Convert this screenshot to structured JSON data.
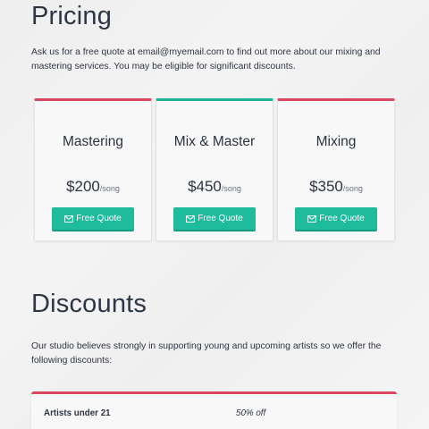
{
  "pricing": {
    "title": "Pricing",
    "intro": "Ask us for a free quote at email@myemail.com to find out more about our mixing and mastering services. You may be eligible for significant discounts.",
    "cards": [
      {
        "name": "Mastering",
        "price": "$200",
        "unit": "/song",
        "button_label": "Free Quote",
        "accent": "#d9485f"
      },
      {
        "name": "Mix & Master",
        "price": "$450",
        "unit": "/song",
        "button_label": "Free Quote",
        "accent": "#1fb394"
      },
      {
        "name": "Mixing",
        "price": "$350",
        "unit": "/song",
        "button_label": "Free Quote",
        "accent": "#d9485f"
      }
    ]
  },
  "discounts": {
    "title": "Discounts",
    "intro": "Our studio believes strongly in supporting young and upcoming artists so we offer the following discounts:",
    "rows": [
      {
        "label": "Artists under 21",
        "value": "50% off"
      }
    ]
  },
  "colors": {
    "button": "#1ebc9c",
    "accent_red": "#d9485f",
    "accent_teal": "#1fb394"
  },
  "icons": {
    "button_icon": "envelope-icon"
  }
}
